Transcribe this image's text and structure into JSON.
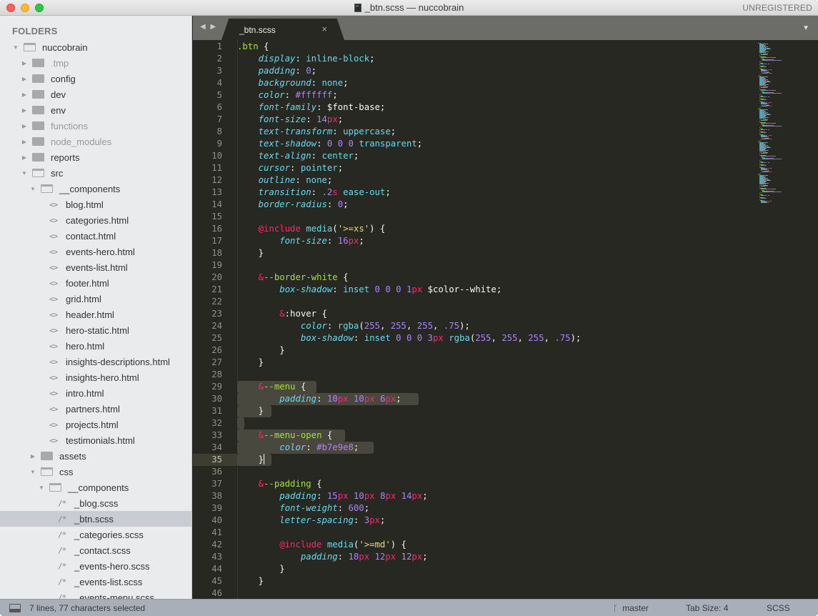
{
  "window": {
    "title": "_btn.scss — nuccobrain",
    "registration": "UNREGISTERED"
  },
  "sidebar": {
    "header": "FOLDERS",
    "tree": [
      {
        "label": "nuccobrain",
        "type": "folder",
        "open": true,
        "depth": 0
      },
      {
        "label": ".tmp",
        "type": "folder",
        "open": false,
        "depth": 1,
        "dim": true
      },
      {
        "label": "config",
        "type": "folder",
        "open": false,
        "depth": 1
      },
      {
        "label": "dev",
        "type": "folder",
        "open": false,
        "depth": 1
      },
      {
        "label": "env",
        "type": "folder",
        "open": false,
        "depth": 1
      },
      {
        "label": "functions",
        "type": "folder",
        "open": false,
        "depth": 1,
        "dim": true
      },
      {
        "label": "node_modules",
        "type": "folder",
        "open": false,
        "depth": 1,
        "dim": true
      },
      {
        "label": "reports",
        "type": "folder",
        "open": false,
        "depth": 1
      },
      {
        "label": "src",
        "type": "folder",
        "open": true,
        "depth": 1
      },
      {
        "label": "__components",
        "type": "folder",
        "open": true,
        "depth": 2
      },
      {
        "label": "blog.html",
        "type": "html",
        "depth": 3
      },
      {
        "label": "categories.html",
        "type": "html",
        "depth": 3
      },
      {
        "label": "contact.html",
        "type": "html",
        "depth": 3
      },
      {
        "label": "events-hero.html",
        "type": "html",
        "depth": 3
      },
      {
        "label": "events-list.html",
        "type": "html",
        "depth": 3
      },
      {
        "label": "footer.html",
        "type": "html",
        "depth": 3
      },
      {
        "label": "grid.html",
        "type": "html",
        "depth": 3
      },
      {
        "label": "header.html",
        "type": "html",
        "depth": 3
      },
      {
        "label": "hero-static.html",
        "type": "html",
        "depth": 3
      },
      {
        "label": "hero.html",
        "type": "html",
        "depth": 3
      },
      {
        "label": "insights-descriptions.html",
        "type": "html",
        "depth": 3
      },
      {
        "label": "insights-hero.html",
        "type": "html",
        "depth": 3
      },
      {
        "label": "intro.html",
        "type": "html",
        "depth": 3
      },
      {
        "label": "partners.html",
        "type": "html",
        "depth": 3
      },
      {
        "label": "projects.html",
        "type": "html",
        "depth": 3
      },
      {
        "label": "testimonials.html",
        "type": "html",
        "depth": 3
      },
      {
        "label": "assets",
        "type": "folder",
        "open": false,
        "depth": 2
      },
      {
        "label": "css",
        "type": "folder",
        "open": true,
        "depth": 2
      },
      {
        "label": "__components",
        "type": "folder",
        "open": true,
        "depth": 3
      },
      {
        "label": "_blog.scss",
        "type": "scss",
        "depth": 4
      },
      {
        "label": "_btn.scss",
        "type": "scss",
        "depth": 4,
        "selected": true
      },
      {
        "label": "_categories.scss",
        "type": "scss",
        "depth": 4
      },
      {
        "label": "_contact.scss",
        "type": "scss",
        "depth": 4
      },
      {
        "label": "_events-hero.scss",
        "type": "scss",
        "depth": 4
      },
      {
        "label": "_events-list.scss",
        "type": "scss",
        "depth": 4
      },
      {
        "label": "_events-menu.scss",
        "type": "scss",
        "depth": 4
      }
    ],
    "icons": {
      "html": "<>",
      "scss": "/*"
    }
  },
  "tabs": {
    "nav_label": "◀ ▶",
    "active": {
      "label": "_btn.scss",
      "close": "×"
    },
    "menu_icon": "▼"
  },
  "editor": {
    "cursor_line": 35,
    "selection_lines": [
      29,
      35
    ],
    "lines": [
      [
        [
          "s",
          ".btn"
        ],
        [
          "w",
          " {"
        ]
      ],
      [
        [
          "w",
          "    "
        ],
        [
          "p",
          "display"
        ],
        [
          "w",
          ": "
        ],
        [
          "v",
          "inline-block"
        ],
        [
          "w",
          ";"
        ]
      ],
      [
        [
          "w",
          "    "
        ],
        [
          "p",
          "padding"
        ],
        [
          "w",
          ": "
        ],
        [
          "n",
          "0"
        ],
        [
          "w",
          ";"
        ]
      ],
      [
        [
          "w",
          "    "
        ],
        [
          "p",
          "background"
        ],
        [
          "w",
          ": "
        ],
        [
          "v",
          "none"
        ],
        [
          "w",
          ";"
        ]
      ],
      [
        [
          "w",
          "    "
        ],
        [
          "p",
          "color"
        ],
        [
          "w",
          ": "
        ],
        [
          "n",
          "#ffffff"
        ],
        [
          "w",
          ";"
        ]
      ],
      [
        [
          "w",
          "    "
        ],
        [
          "p",
          "font-family"
        ],
        [
          "w",
          ": $font-base;"
        ]
      ],
      [
        [
          "w",
          "    "
        ],
        [
          "p",
          "font-size"
        ],
        [
          "w",
          ": "
        ],
        [
          "n",
          "14"
        ],
        [
          "u",
          "px"
        ],
        [
          "w",
          ";"
        ]
      ],
      [
        [
          "w",
          "    "
        ],
        [
          "p",
          "text-transform"
        ],
        [
          "w",
          ": "
        ],
        [
          "v",
          "uppercase"
        ],
        [
          "w",
          ";"
        ]
      ],
      [
        [
          "w",
          "    "
        ],
        [
          "p",
          "text-shadow"
        ],
        [
          "w",
          ": "
        ],
        [
          "n",
          "0 0 0"
        ],
        [
          "w",
          " "
        ],
        [
          "v",
          "transparent"
        ],
        [
          "w",
          ";"
        ]
      ],
      [
        [
          "w",
          "    "
        ],
        [
          "p",
          "text-align"
        ],
        [
          "w",
          ": "
        ],
        [
          "v",
          "center"
        ],
        [
          "w",
          ";"
        ]
      ],
      [
        [
          "w",
          "    "
        ],
        [
          "p",
          "cursor"
        ],
        [
          "w",
          ": "
        ],
        [
          "v",
          "pointer"
        ],
        [
          "w",
          ";"
        ]
      ],
      [
        [
          "w",
          "    "
        ],
        [
          "p",
          "outline"
        ],
        [
          "w",
          ": "
        ],
        [
          "v",
          "none"
        ],
        [
          "w",
          ";"
        ]
      ],
      [
        [
          "w",
          "    "
        ],
        [
          "p",
          "transition"
        ],
        [
          "w",
          ": "
        ],
        [
          "n",
          ".2"
        ],
        [
          "u",
          "s"
        ],
        [
          "w",
          " "
        ],
        [
          "v",
          "ease-out"
        ],
        [
          "w",
          ";"
        ]
      ],
      [
        [
          "w",
          "    "
        ],
        [
          "p",
          "border-radius"
        ],
        [
          "w",
          ": "
        ],
        [
          "n",
          "0"
        ],
        [
          "w",
          ";"
        ]
      ],
      [],
      [
        [
          "w",
          "    "
        ],
        [
          "k",
          "@include"
        ],
        [
          "w",
          " "
        ],
        [
          "v",
          "media"
        ],
        [
          "w",
          "("
        ],
        [
          "str",
          "'>=xs'"
        ],
        [
          "w",
          ") {"
        ]
      ],
      [
        [
          "w",
          "        "
        ],
        [
          "p",
          "font-size"
        ],
        [
          "w",
          ": "
        ],
        [
          "n",
          "16"
        ],
        [
          "u",
          "px"
        ],
        [
          "w",
          ";"
        ]
      ],
      [
        [
          "w",
          "    }"
        ]
      ],
      [],
      [
        [
          "w",
          "    "
        ],
        [
          "k",
          "&"
        ],
        [
          "s",
          "--border-white"
        ],
        [
          "w",
          " {"
        ]
      ],
      [
        [
          "w",
          "        "
        ],
        [
          "p",
          "box-shadow"
        ],
        [
          "w",
          ": "
        ],
        [
          "v",
          "inset"
        ],
        [
          "w",
          " "
        ],
        [
          "n",
          "0 0 0 1"
        ],
        [
          "u",
          "px"
        ],
        [
          "w",
          " $color--white;"
        ]
      ],
      [],
      [
        [
          "w",
          "        "
        ],
        [
          "k",
          "&"
        ],
        [
          "w",
          ":hover {"
        ]
      ],
      [
        [
          "w",
          "            "
        ],
        [
          "p",
          "color"
        ],
        [
          "w",
          ": "
        ],
        [
          "v",
          "rgba"
        ],
        [
          "w",
          "("
        ],
        [
          "n",
          "255"
        ],
        [
          "w",
          ", "
        ],
        [
          "n",
          "255"
        ],
        [
          "w",
          ", "
        ],
        [
          "n",
          "255"
        ],
        [
          "w",
          ", "
        ],
        [
          "n",
          ".75"
        ],
        [
          "w",
          ");"
        ]
      ],
      [
        [
          "w",
          "            "
        ],
        [
          "p",
          "box-shadow"
        ],
        [
          "w",
          ": "
        ],
        [
          "v",
          "inset"
        ],
        [
          "w",
          " "
        ],
        [
          "n",
          "0 0 0 3"
        ],
        [
          "u",
          "px"
        ],
        [
          "w",
          " "
        ],
        [
          "v",
          "rgba"
        ],
        [
          "w",
          "("
        ],
        [
          "n",
          "255"
        ],
        [
          "w",
          ", "
        ],
        [
          "n",
          "255"
        ],
        [
          "w",
          ", "
        ],
        [
          "n",
          "255"
        ],
        [
          "w",
          ", "
        ],
        [
          "n",
          ".75"
        ],
        [
          "w",
          ");"
        ]
      ],
      [
        [
          "w",
          "        }"
        ]
      ],
      [
        [
          "w",
          "    }"
        ]
      ],
      [],
      [
        [
          "w",
          "    "
        ],
        [
          "k",
          "&"
        ],
        [
          "s",
          "--menu"
        ],
        [
          "w",
          " {"
        ]
      ],
      [
        [
          "w",
          "        "
        ],
        [
          "p",
          "padding"
        ],
        [
          "w",
          ": "
        ],
        [
          "n",
          "10"
        ],
        [
          "u",
          "px"
        ],
        [
          "w",
          " "
        ],
        [
          "n",
          "10"
        ],
        [
          "u",
          "px"
        ],
        [
          "w",
          " "
        ],
        [
          "n",
          "6"
        ],
        [
          "u",
          "px"
        ],
        [
          "w",
          ";"
        ]
      ],
      [
        [
          "w",
          "    }"
        ]
      ],
      [],
      [
        [
          "w",
          "    "
        ],
        [
          "k",
          "&"
        ],
        [
          "s",
          "--menu-open"
        ],
        [
          "w",
          " {"
        ]
      ],
      [
        [
          "w",
          "        "
        ],
        [
          "p",
          "color"
        ],
        [
          "w",
          ": "
        ],
        [
          "n",
          "#b7e9e8"
        ],
        [
          "w",
          ";"
        ]
      ],
      [
        [
          "w",
          "    }"
        ]
      ],
      [],
      [
        [
          "w",
          "    "
        ],
        [
          "k",
          "&"
        ],
        [
          "s",
          "--padding"
        ],
        [
          "w",
          " {"
        ]
      ],
      [
        [
          "w",
          "        "
        ],
        [
          "p",
          "padding"
        ],
        [
          "w",
          ": "
        ],
        [
          "n",
          "15"
        ],
        [
          "u",
          "px"
        ],
        [
          "w",
          " "
        ],
        [
          "n",
          "10"
        ],
        [
          "u",
          "px"
        ],
        [
          "w",
          " "
        ],
        [
          "n",
          "8"
        ],
        [
          "u",
          "px"
        ],
        [
          "w",
          " "
        ],
        [
          "n",
          "14"
        ],
        [
          "u",
          "px"
        ],
        [
          "w",
          ";"
        ]
      ],
      [
        [
          "w",
          "        "
        ],
        [
          "p",
          "font-weight"
        ],
        [
          "w",
          ": "
        ],
        [
          "n",
          "600"
        ],
        [
          "w",
          ";"
        ]
      ],
      [
        [
          "w",
          "        "
        ],
        [
          "p",
          "letter-spacing"
        ],
        [
          "w",
          ": "
        ],
        [
          "n",
          "3"
        ],
        [
          "u",
          "px"
        ],
        [
          "w",
          ";"
        ]
      ],
      [],
      [
        [
          "w",
          "        "
        ],
        [
          "k",
          "@include"
        ],
        [
          "w",
          " "
        ],
        [
          "v",
          "media"
        ],
        [
          "w",
          "("
        ],
        [
          "str",
          "'>=md'"
        ],
        [
          "w",
          ") {"
        ]
      ],
      [
        [
          "w",
          "            "
        ],
        [
          "p",
          "padding"
        ],
        [
          "w",
          ": "
        ],
        [
          "n",
          "18"
        ],
        [
          "u",
          "px"
        ],
        [
          "w",
          " "
        ],
        [
          "n",
          "12"
        ],
        [
          "u",
          "px"
        ],
        [
          "w",
          " "
        ],
        [
          "n",
          "12"
        ],
        [
          "u",
          "px"
        ],
        [
          "w",
          ";"
        ]
      ],
      [
        [
          "w",
          "        }"
        ]
      ],
      [
        [
          "w",
          "    }"
        ]
      ],
      []
    ]
  },
  "statusbar": {
    "selection": "7 lines, 77 characters selected",
    "branch": "master",
    "tab_size": "Tab Size: 4",
    "syntax": "SCSS"
  }
}
